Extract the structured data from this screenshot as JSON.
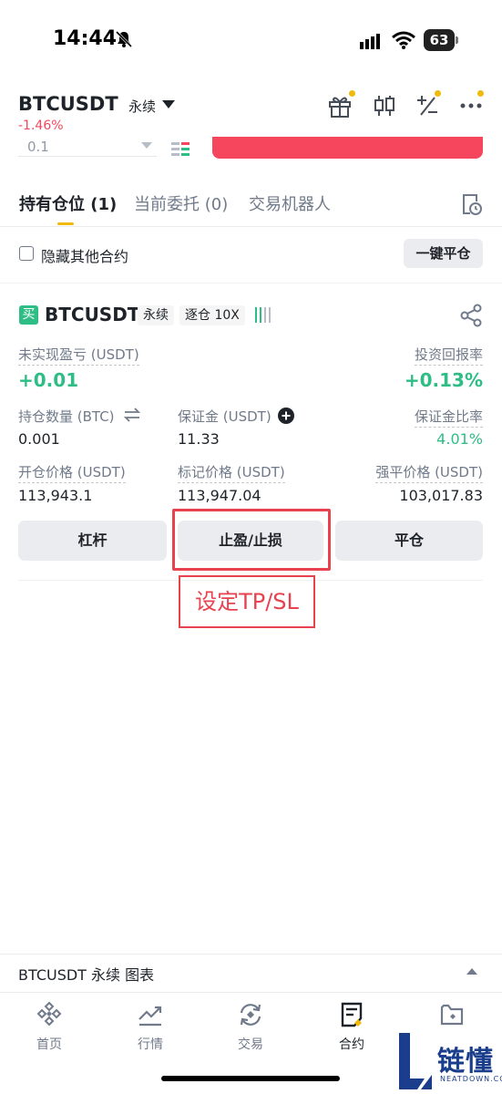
{
  "status": {
    "time": "14:44",
    "battery": "63"
  },
  "header": {
    "pair": "BTCUSDT",
    "type": "永续",
    "change": "-1.46%"
  },
  "order_peek": {
    "quantity": "0.1"
  },
  "tabs": [
    {
      "label": "持有仓位 (1)"
    },
    {
      "label": "当前委托 (0)"
    },
    {
      "label": "交易机器人"
    }
  ],
  "filter": {
    "hide_other": "隐藏其他合约",
    "close_all": "一键平仓"
  },
  "position": {
    "side_badge": "买",
    "symbol": "BTCUSDT",
    "type": "永续",
    "margin_mode": "逐仓 10X",
    "unrealized_pnl_label": "未实现盈亏 (USDT)",
    "unrealized_pnl": "+0.01",
    "roi_label": "投资回报率",
    "roi": "+0.13%",
    "size_label": "持仓数量 (BTC)",
    "size": "0.001",
    "margin_label": "保证金 (USDT)",
    "margin": "11.33",
    "margin_ratio_label": "保证金比率",
    "margin_ratio": "4.01%",
    "entry_label": "开仓价格 (USDT)",
    "entry": "113,943.1",
    "mark_label": "标记价格 (USDT)",
    "mark": "113,947.04",
    "liq_label": "强平价格 (USDT)",
    "liq": "103,017.83"
  },
  "actions": {
    "leverage": "杠杆",
    "tpsl": "止盈/止损",
    "close": "平仓"
  },
  "annotation": "设定TP/SL",
  "chart_bar": {
    "label": "BTCUSDT 永续  图表"
  },
  "nav": [
    {
      "label": "首页"
    },
    {
      "label": "行情"
    },
    {
      "label": "交易"
    },
    {
      "label": "合约"
    },
    {
      "label": ""
    }
  ],
  "watermark": {
    "text": "链懂",
    "sub": "NEATDOWN.COM"
  },
  "colors": {
    "up": "#2ebd85",
    "down": "#f6465d",
    "accent": "#f0b90b",
    "annotation": "#e8424f"
  }
}
